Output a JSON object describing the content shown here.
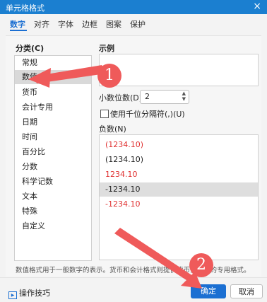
{
  "window": {
    "title": "单元格格式",
    "close_glyph": "×"
  },
  "tabs": [
    {
      "label": "数字",
      "active": true
    },
    {
      "label": "对齐"
    },
    {
      "label": "字体"
    },
    {
      "label": "边框"
    },
    {
      "label": "图案"
    },
    {
      "label": "保护"
    }
  ],
  "category": {
    "label": "分类(C)",
    "items": [
      "常规",
      "数值",
      "货币",
      "会计专用",
      "日期",
      "时间",
      "百分比",
      "分数",
      "科学记数",
      "文本",
      "特殊",
      "自定义"
    ],
    "selected": "数值"
  },
  "sample": {
    "label": "示例",
    "value": ""
  },
  "decimal_places": {
    "label": "小数位数(D)",
    "value": "2"
  },
  "thousands_separator": {
    "label": "使用千位分隔符(,)(U)",
    "checked": false
  },
  "negative_numbers": {
    "label": "负数(N)",
    "items": [
      {
        "text": "(1234.10)",
        "color": "#e03030"
      },
      {
        "text": "(1234.10)",
        "color": "#222222"
      },
      {
        "text": "1234.10",
        "color": "#e03030"
      },
      {
        "text": "-1234.10",
        "color": "#222222",
        "selected": true
      },
      {
        "text": "-1234.10",
        "color": "#e03030"
      }
    ]
  },
  "description": "数值格式用于一般数字的表示。货币和会计格式则提供货币值计算的专用格式。",
  "footer": {
    "tips_label": "操作技巧",
    "ok_label": "确定",
    "cancel_label": "取消"
  },
  "annotations": [
    {
      "number": "1"
    },
    {
      "number": "2"
    }
  ],
  "colors": {
    "accent": "#1b6fd2",
    "titlebar": "#1b7fd0",
    "annotation": "#ef5a5a"
  }
}
